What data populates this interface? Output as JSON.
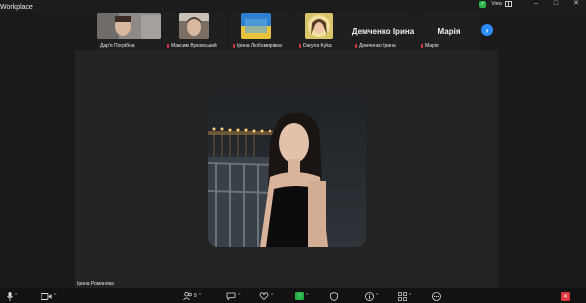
{
  "window": {
    "app_title": "Workplace",
    "view_label": "View"
  },
  "participants": [
    {
      "name": "Дар'я Погрібна",
      "type": "video"
    },
    {
      "name": "Максим Вуковський",
      "type": "video"
    },
    {
      "name": "Ірина Любомирівна",
      "type": "video"
    },
    {
      "name": "Daryna Kyka",
      "type": "video"
    },
    {
      "name": "Демченко Ірина",
      "display": "Демченко Ірина",
      "type": "name"
    },
    {
      "name": "Марія",
      "display": "Марія",
      "type": "name"
    }
  ],
  "active_speaker": {
    "name": "Ірина Романова"
  },
  "toolbar": {
    "participants_count": "8",
    "icons": [
      "mic-icon",
      "video-icon",
      "participants-icon",
      "chat-icon",
      "reactions-icon",
      "share-screen-icon",
      "security-icon",
      "info-icon",
      "apps-icon",
      "more-icon",
      "leave-icon"
    ]
  },
  "colors": {
    "accent": "#2d8cff",
    "share": "#27b24a",
    "muted": "#e0383e",
    "leave": "#e0383e"
  }
}
